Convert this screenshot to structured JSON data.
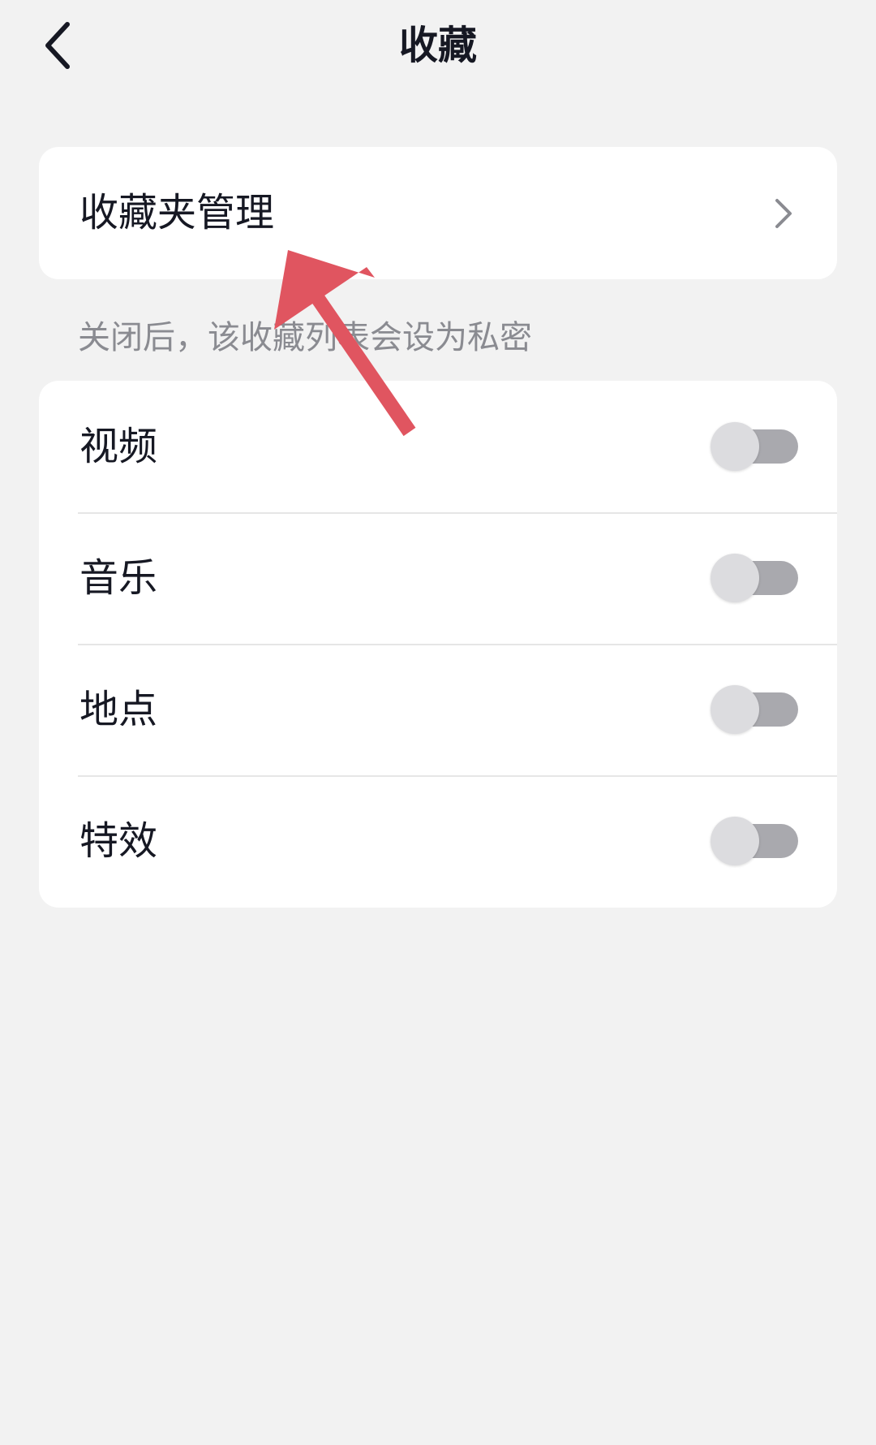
{
  "nav": {
    "title": "收藏"
  },
  "manage_card": {
    "label": "收藏夹管理"
  },
  "hint": "关闭后，该收藏列表会设为私密",
  "toggles": [
    {
      "label": "视频",
      "on": false
    },
    {
      "label": "音乐",
      "on": false
    },
    {
      "label": "地点",
      "on": false
    },
    {
      "label": "特效",
      "on": false
    }
  ],
  "colors": {
    "background": "#f2f2f2",
    "card": "#ffffff",
    "text": "#161823",
    "hint_text": "#8a8b91",
    "switch_track_off": "#a9a9ae",
    "switch_knob": "#dcdcdf",
    "annotation_arrow": "#e05560"
  },
  "icons": {
    "back": "chevron-left-icon",
    "row_arrow": "chevron-right-icon"
  }
}
